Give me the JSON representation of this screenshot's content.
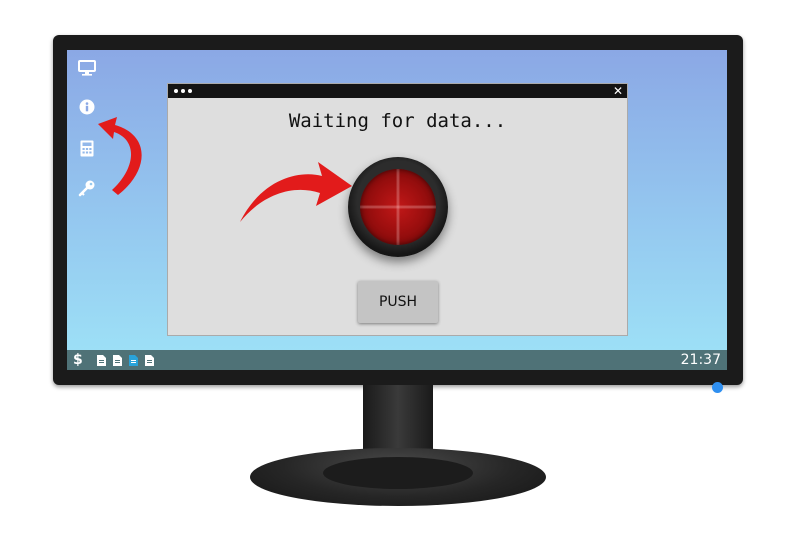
{
  "window": {
    "status": "Waiting for data...",
    "push_label": "PUSH"
  },
  "taskbar": {
    "dollar": "$",
    "clock": "21:37"
  },
  "desktop_icons": [
    "monitor-icon",
    "info-icon",
    "calculator-icon",
    "key-icon"
  ],
  "colors": {
    "screen_top": "#8ba8e5",
    "screen_bottom": "#9ee3f7",
    "taskbar": "#4f7277",
    "arrow": "#e21b1b",
    "big_button": "#b01212",
    "active_file": "#29a3d9",
    "power_led": "#2f8ff0"
  }
}
